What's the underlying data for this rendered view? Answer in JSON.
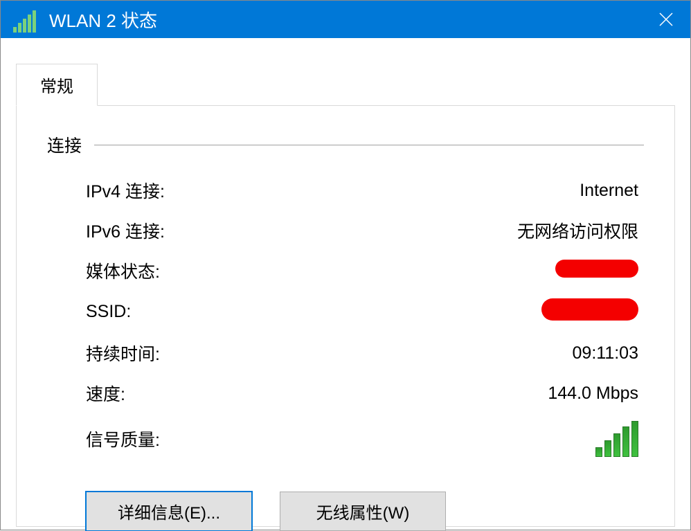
{
  "titlebar": {
    "title": "WLAN 2 状态"
  },
  "tabs": [
    {
      "label": "常规"
    }
  ],
  "group": {
    "connection_label": "连接"
  },
  "fields": {
    "ipv4_label": "IPv4 连接:",
    "ipv4_value": "Internet",
    "ipv6_label": "IPv6 连接:",
    "ipv6_value": "无网络访问权限",
    "media_label": "媒体状态:",
    "media_value_redacted": true,
    "ssid_label": "SSID:",
    "ssid_value_redacted": true,
    "duration_label": "持续时间:",
    "duration_value": "09:11:03",
    "speed_label": "速度:",
    "speed_value": "144.0 Mbps",
    "signal_label": "信号质量:"
  },
  "buttons": {
    "details": "详细信息(E)...",
    "wireless_props": "无线属性(W)"
  }
}
